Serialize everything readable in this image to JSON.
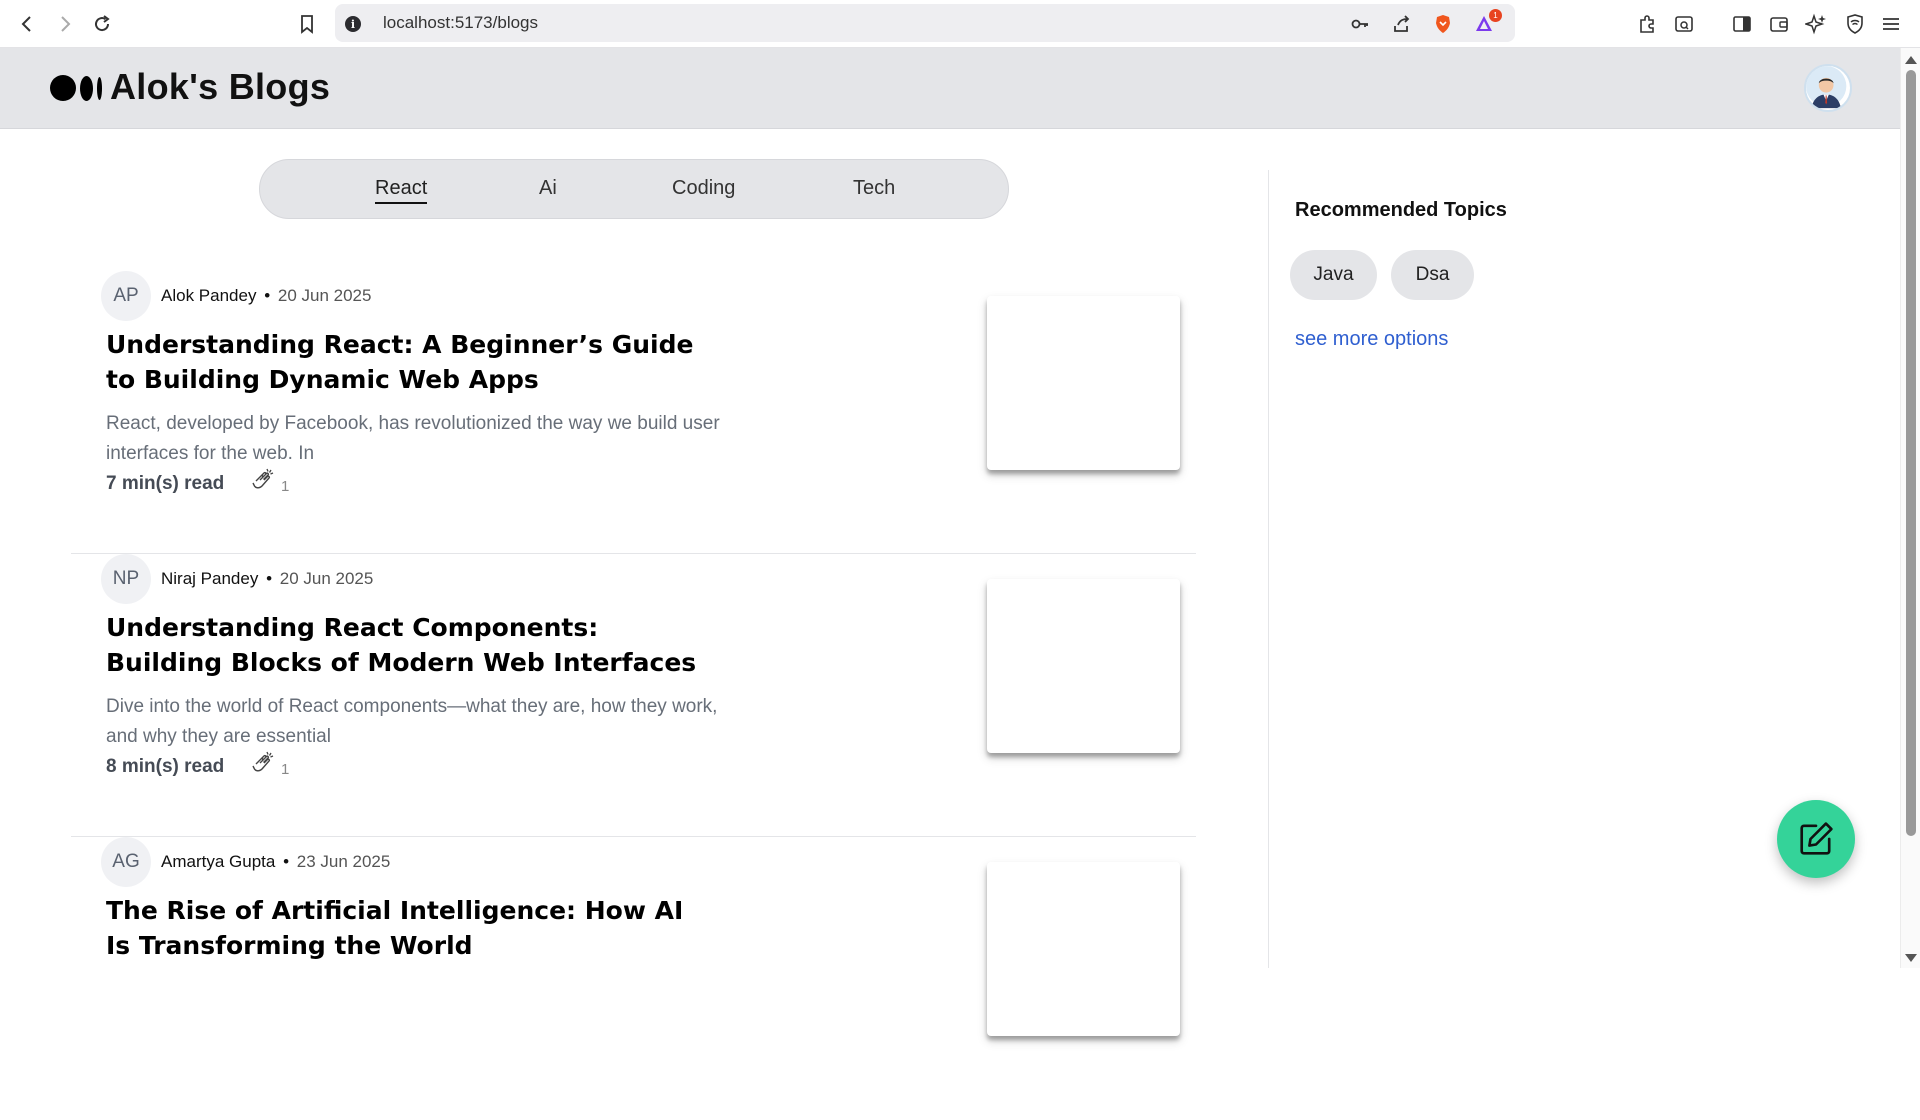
{
  "browser": {
    "url": "localhost:5173/blogs",
    "icons": [
      "back-icon",
      "forward-icon",
      "reload-icon",
      "bookmark-icon",
      "site-info-icon",
      "key-icon",
      "share-icon",
      "brave-shields-icon",
      "brave-rewards-icon",
      "extensions-icon",
      "search-tab-icon",
      "sidebar-icon",
      "wallet-icon",
      "leo-ai-icon",
      "vpn-icon",
      "menu-icon"
    ],
    "rewards_badge": "1"
  },
  "header": {
    "brand": "Alok's Blogs"
  },
  "tabs": [
    {
      "label": "React",
      "active": true
    },
    {
      "label": "Ai",
      "active": false
    },
    {
      "label": "Coding",
      "active": false
    },
    {
      "label": "Tech",
      "active": false
    }
  ],
  "posts": [
    {
      "initials": "AP",
      "author": "Alok Pandey",
      "separator": "•",
      "date": "20 Jun 2025",
      "title": "Understanding React: A Beginner’s Guide to Building Dynamic Web Apps",
      "excerpt": "React, developed by Facebook, has revolutionized the way we build user interfaces for the web. In",
      "read_time": "7 min(s) read",
      "claps": "1"
    },
    {
      "initials": "NP",
      "author": "Niraj Pandey",
      "separator": "•",
      "date": "20 Jun 2025",
      "title": "Understanding React Components: Building Blocks of Modern Web Interfaces",
      "excerpt": "Dive into the world of React components—what they are, how they work, and why they are essential",
      "read_time": "8 min(s) read",
      "claps": "1"
    },
    {
      "initials": "AG",
      "author": "Amartya Gupta",
      "separator": "•",
      "date": "23 Jun 2025",
      "title": "The Rise of Artificial Intelligence: How AI Is Transforming the World",
      "excerpt": "",
      "read_time": "",
      "claps": ""
    }
  ],
  "sidebar": {
    "title": "Recommended Topics",
    "topics": [
      "Java",
      "Dsa"
    ],
    "see_more": "see more options"
  },
  "colors": {
    "header_bg": "#e4e5e8",
    "fab": "#34d399",
    "link": "#2f5fd0"
  }
}
